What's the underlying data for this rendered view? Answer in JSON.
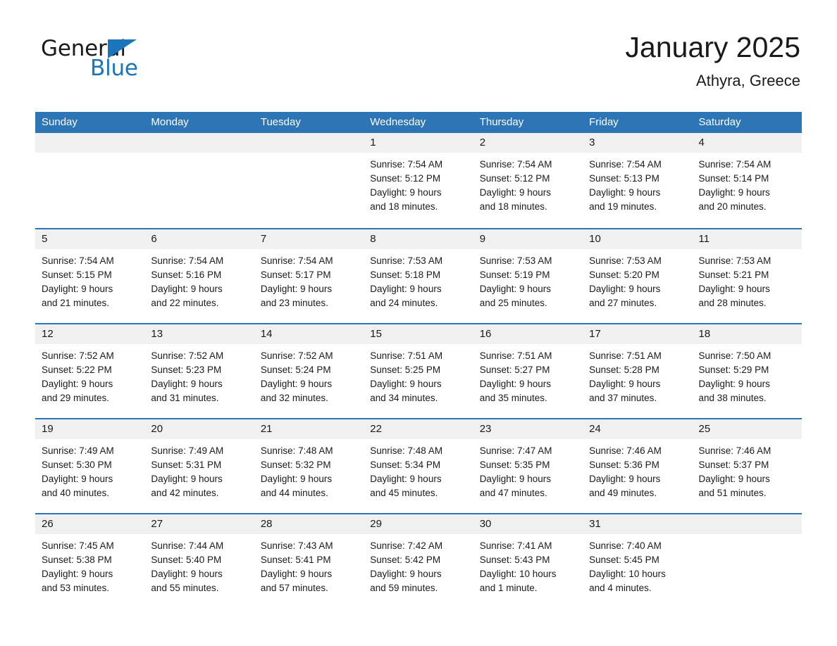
{
  "logo": {
    "word1": "General",
    "word2": "Blue",
    "triangle_color": "#1b75bb"
  },
  "header": {
    "title": "January 2025",
    "location": "Athyra, Greece"
  },
  "theme": {
    "header_blue": "#2e75b6",
    "band_gray": "#f0f0f0",
    "text": "#1a1a1a"
  },
  "calendar": {
    "weekdays": [
      "Sunday",
      "Monday",
      "Tuesday",
      "Wednesday",
      "Thursday",
      "Friday",
      "Saturday"
    ],
    "weeks": [
      [
        {
          "day": "",
          "sunrise": "",
          "sunset": "",
          "daylight1": "",
          "daylight2": ""
        },
        {
          "day": "",
          "sunrise": "",
          "sunset": "",
          "daylight1": "",
          "daylight2": ""
        },
        {
          "day": "",
          "sunrise": "",
          "sunset": "",
          "daylight1": "",
          "daylight2": ""
        },
        {
          "day": "1",
          "sunrise": "Sunrise: 7:54 AM",
          "sunset": "Sunset: 5:12 PM",
          "daylight1": "Daylight: 9 hours",
          "daylight2": "and 18 minutes."
        },
        {
          "day": "2",
          "sunrise": "Sunrise: 7:54 AM",
          "sunset": "Sunset: 5:12 PM",
          "daylight1": "Daylight: 9 hours",
          "daylight2": "and 18 minutes."
        },
        {
          "day": "3",
          "sunrise": "Sunrise: 7:54 AM",
          "sunset": "Sunset: 5:13 PM",
          "daylight1": "Daylight: 9 hours",
          "daylight2": "and 19 minutes."
        },
        {
          "day": "4",
          "sunrise": "Sunrise: 7:54 AM",
          "sunset": "Sunset: 5:14 PM",
          "daylight1": "Daylight: 9 hours",
          "daylight2": "and 20 minutes."
        }
      ],
      [
        {
          "day": "5",
          "sunrise": "Sunrise: 7:54 AM",
          "sunset": "Sunset: 5:15 PM",
          "daylight1": "Daylight: 9 hours",
          "daylight2": "and 21 minutes."
        },
        {
          "day": "6",
          "sunrise": "Sunrise: 7:54 AM",
          "sunset": "Sunset: 5:16 PM",
          "daylight1": "Daylight: 9 hours",
          "daylight2": "and 22 minutes."
        },
        {
          "day": "7",
          "sunrise": "Sunrise: 7:54 AM",
          "sunset": "Sunset: 5:17 PM",
          "daylight1": "Daylight: 9 hours",
          "daylight2": "and 23 minutes."
        },
        {
          "day": "8",
          "sunrise": "Sunrise: 7:53 AM",
          "sunset": "Sunset: 5:18 PM",
          "daylight1": "Daylight: 9 hours",
          "daylight2": "and 24 minutes."
        },
        {
          "day": "9",
          "sunrise": "Sunrise: 7:53 AM",
          "sunset": "Sunset: 5:19 PM",
          "daylight1": "Daylight: 9 hours",
          "daylight2": "and 25 minutes."
        },
        {
          "day": "10",
          "sunrise": "Sunrise: 7:53 AM",
          "sunset": "Sunset: 5:20 PM",
          "daylight1": "Daylight: 9 hours",
          "daylight2": "and 27 minutes."
        },
        {
          "day": "11",
          "sunrise": "Sunrise: 7:53 AM",
          "sunset": "Sunset: 5:21 PM",
          "daylight1": "Daylight: 9 hours",
          "daylight2": "and 28 minutes."
        }
      ],
      [
        {
          "day": "12",
          "sunrise": "Sunrise: 7:52 AM",
          "sunset": "Sunset: 5:22 PM",
          "daylight1": "Daylight: 9 hours",
          "daylight2": "and 29 minutes."
        },
        {
          "day": "13",
          "sunrise": "Sunrise: 7:52 AM",
          "sunset": "Sunset: 5:23 PM",
          "daylight1": "Daylight: 9 hours",
          "daylight2": "and 31 minutes."
        },
        {
          "day": "14",
          "sunrise": "Sunrise: 7:52 AM",
          "sunset": "Sunset: 5:24 PM",
          "daylight1": "Daylight: 9 hours",
          "daylight2": "and 32 minutes."
        },
        {
          "day": "15",
          "sunrise": "Sunrise: 7:51 AM",
          "sunset": "Sunset: 5:25 PM",
          "daylight1": "Daylight: 9 hours",
          "daylight2": "and 34 minutes."
        },
        {
          "day": "16",
          "sunrise": "Sunrise: 7:51 AM",
          "sunset": "Sunset: 5:27 PM",
          "daylight1": "Daylight: 9 hours",
          "daylight2": "and 35 minutes."
        },
        {
          "day": "17",
          "sunrise": "Sunrise: 7:51 AM",
          "sunset": "Sunset: 5:28 PM",
          "daylight1": "Daylight: 9 hours",
          "daylight2": "and 37 minutes."
        },
        {
          "day": "18",
          "sunrise": "Sunrise: 7:50 AM",
          "sunset": "Sunset: 5:29 PM",
          "daylight1": "Daylight: 9 hours",
          "daylight2": "and 38 minutes."
        }
      ],
      [
        {
          "day": "19",
          "sunrise": "Sunrise: 7:49 AM",
          "sunset": "Sunset: 5:30 PM",
          "daylight1": "Daylight: 9 hours",
          "daylight2": "and 40 minutes."
        },
        {
          "day": "20",
          "sunrise": "Sunrise: 7:49 AM",
          "sunset": "Sunset: 5:31 PM",
          "daylight1": "Daylight: 9 hours",
          "daylight2": "and 42 minutes."
        },
        {
          "day": "21",
          "sunrise": "Sunrise: 7:48 AM",
          "sunset": "Sunset: 5:32 PM",
          "daylight1": "Daylight: 9 hours",
          "daylight2": "and 44 minutes."
        },
        {
          "day": "22",
          "sunrise": "Sunrise: 7:48 AM",
          "sunset": "Sunset: 5:34 PM",
          "daylight1": "Daylight: 9 hours",
          "daylight2": "and 45 minutes."
        },
        {
          "day": "23",
          "sunrise": "Sunrise: 7:47 AM",
          "sunset": "Sunset: 5:35 PM",
          "daylight1": "Daylight: 9 hours",
          "daylight2": "and 47 minutes."
        },
        {
          "day": "24",
          "sunrise": "Sunrise: 7:46 AM",
          "sunset": "Sunset: 5:36 PM",
          "daylight1": "Daylight: 9 hours",
          "daylight2": "and 49 minutes."
        },
        {
          "day": "25",
          "sunrise": "Sunrise: 7:46 AM",
          "sunset": "Sunset: 5:37 PM",
          "daylight1": "Daylight: 9 hours",
          "daylight2": "and 51 minutes."
        }
      ],
      [
        {
          "day": "26",
          "sunrise": "Sunrise: 7:45 AM",
          "sunset": "Sunset: 5:38 PM",
          "daylight1": "Daylight: 9 hours",
          "daylight2": "and 53 minutes."
        },
        {
          "day": "27",
          "sunrise": "Sunrise: 7:44 AM",
          "sunset": "Sunset: 5:40 PM",
          "daylight1": "Daylight: 9 hours",
          "daylight2": "and 55 minutes."
        },
        {
          "day": "28",
          "sunrise": "Sunrise: 7:43 AM",
          "sunset": "Sunset: 5:41 PM",
          "daylight1": "Daylight: 9 hours",
          "daylight2": "and 57 minutes."
        },
        {
          "day": "29",
          "sunrise": "Sunrise: 7:42 AM",
          "sunset": "Sunset: 5:42 PM",
          "daylight1": "Daylight: 9 hours",
          "daylight2": "and 59 minutes."
        },
        {
          "day": "30",
          "sunrise": "Sunrise: 7:41 AM",
          "sunset": "Sunset: 5:43 PM",
          "daylight1": "Daylight: 10 hours",
          "daylight2": "and 1 minute."
        },
        {
          "day": "31",
          "sunrise": "Sunrise: 7:40 AM",
          "sunset": "Sunset: 5:45 PM",
          "daylight1": "Daylight: 10 hours",
          "daylight2": "and 4 minutes."
        },
        {
          "day": "",
          "sunrise": "",
          "sunset": "",
          "daylight1": "",
          "daylight2": ""
        }
      ]
    ]
  }
}
